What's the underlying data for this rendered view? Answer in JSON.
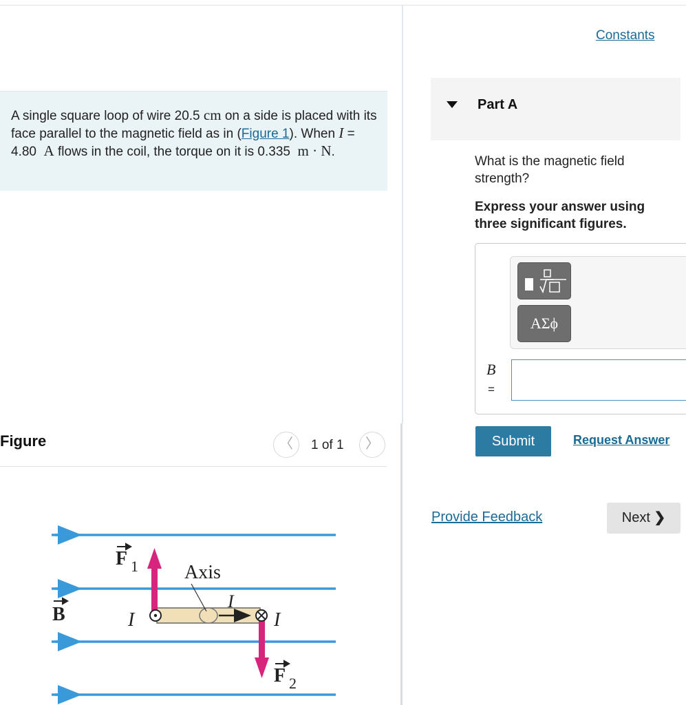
{
  "header": {
    "constants_link": "Constants"
  },
  "problem": {
    "text_1": "A single square loop of wire 20.5",
    "unit_cm": "cm",
    "text_2": "on a side is placed with its face parallel to the magnetic field as in (",
    "figure_link": "Figure 1",
    "text_3": "). When",
    "current_symbol": "I",
    "text_4": "= 4.80",
    "unit_a": "A",
    "text_5": "flows in the coil, the torque on it is 0.335",
    "unit_mn": "m · N",
    "text_6": "."
  },
  "figure": {
    "header": "Figure",
    "prev_icon": "chevron-left-icon",
    "count": "1 of 1",
    "next_icon": "chevron-right-icon",
    "labels": {
      "f1": "F",
      "f1_sub": "1",
      "axis": "Axis",
      "b": "B",
      "i_left": "I",
      "i_mid": "I",
      "i_right": "I",
      "f2": "F",
      "f2_sub": "2"
    },
    "colors": {
      "field_lines": "#3a9ad9",
      "forces": "#d6257c",
      "loop": "#f1dfb8"
    }
  },
  "part": {
    "title": "Part A",
    "caret_icon": "caret-down-icon",
    "question": "What is the magnetic field strength?",
    "instruction": "Express your answer using three significant figures.",
    "toolbar": {
      "templates_icon": "fraction-root-icon",
      "greek_button": "ΑΣϕ"
    },
    "variable": "B",
    "equals": "=",
    "answer_value": "",
    "submit": "Submit",
    "request_answer": "Request Answer"
  },
  "footer": {
    "feedback": "Provide Feedback",
    "next": "Next",
    "next_icon": "chevron-right-icon"
  }
}
